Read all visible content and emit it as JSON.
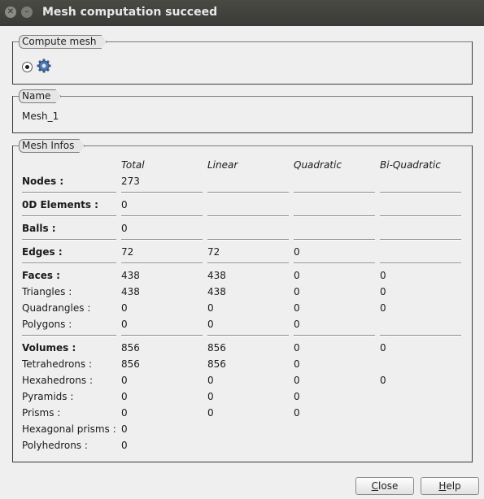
{
  "window": {
    "title": "Mesh computation succeed"
  },
  "compute_group": {
    "label": "Compute mesh"
  },
  "name_group": {
    "label": "Name",
    "value": "Mesh_1"
  },
  "info_group": {
    "label": "Mesh Infos",
    "headers": [
      "Total",
      "Linear",
      "Quadratic",
      "Bi-Quadratic"
    ],
    "rows": [
      {
        "label": "Nodes :",
        "values": [
          "273",
          "",
          "",
          ""
        ]
      },
      {
        "label": "0D Elements :",
        "values": [
          "0",
          "",
          "",
          ""
        ]
      },
      {
        "label": "Balls :",
        "values": [
          "0",
          "",
          "",
          ""
        ]
      },
      {
        "label": "Edges :",
        "values": [
          "72",
          "72",
          "0",
          ""
        ]
      },
      {
        "label": "Faces :",
        "values": [
          "438",
          "438",
          "0",
          "0"
        ]
      },
      {
        "label": "Triangles :",
        "values": [
          "438",
          "438",
          "0",
          "0"
        ]
      },
      {
        "label": "Quadrangles :",
        "values": [
          "0",
          "0",
          "0",
          "0"
        ]
      },
      {
        "label": "Polygons :",
        "values": [
          "0",
          "0",
          "0",
          ""
        ]
      },
      {
        "label": "Volumes :",
        "values": [
          "856",
          "856",
          "0",
          "0"
        ]
      },
      {
        "label": "Tetrahedrons :",
        "values": [
          "856",
          "856",
          "0",
          ""
        ]
      },
      {
        "label": "Hexahedrons :",
        "values": [
          "0",
          "0",
          "0",
          "0"
        ]
      },
      {
        "label": "Pyramids :",
        "values": [
          "0",
          "0",
          "0",
          ""
        ]
      },
      {
        "label": "Prisms :",
        "values": [
          "0",
          "0",
          "0",
          ""
        ]
      },
      {
        "label": "Hexagonal prisms :",
        "values": [
          "0",
          "",
          "",
          ""
        ]
      },
      {
        "label": "Polyhedrons :",
        "values": [
          "0",
          "",
          "",
          ""
        ]
      }
    ]
  },
  "buttons": {
    "close_first": "C",
    "close_rest": "lose",
    "help_first": "H",
    "help_rest": "elp"
  }
}
